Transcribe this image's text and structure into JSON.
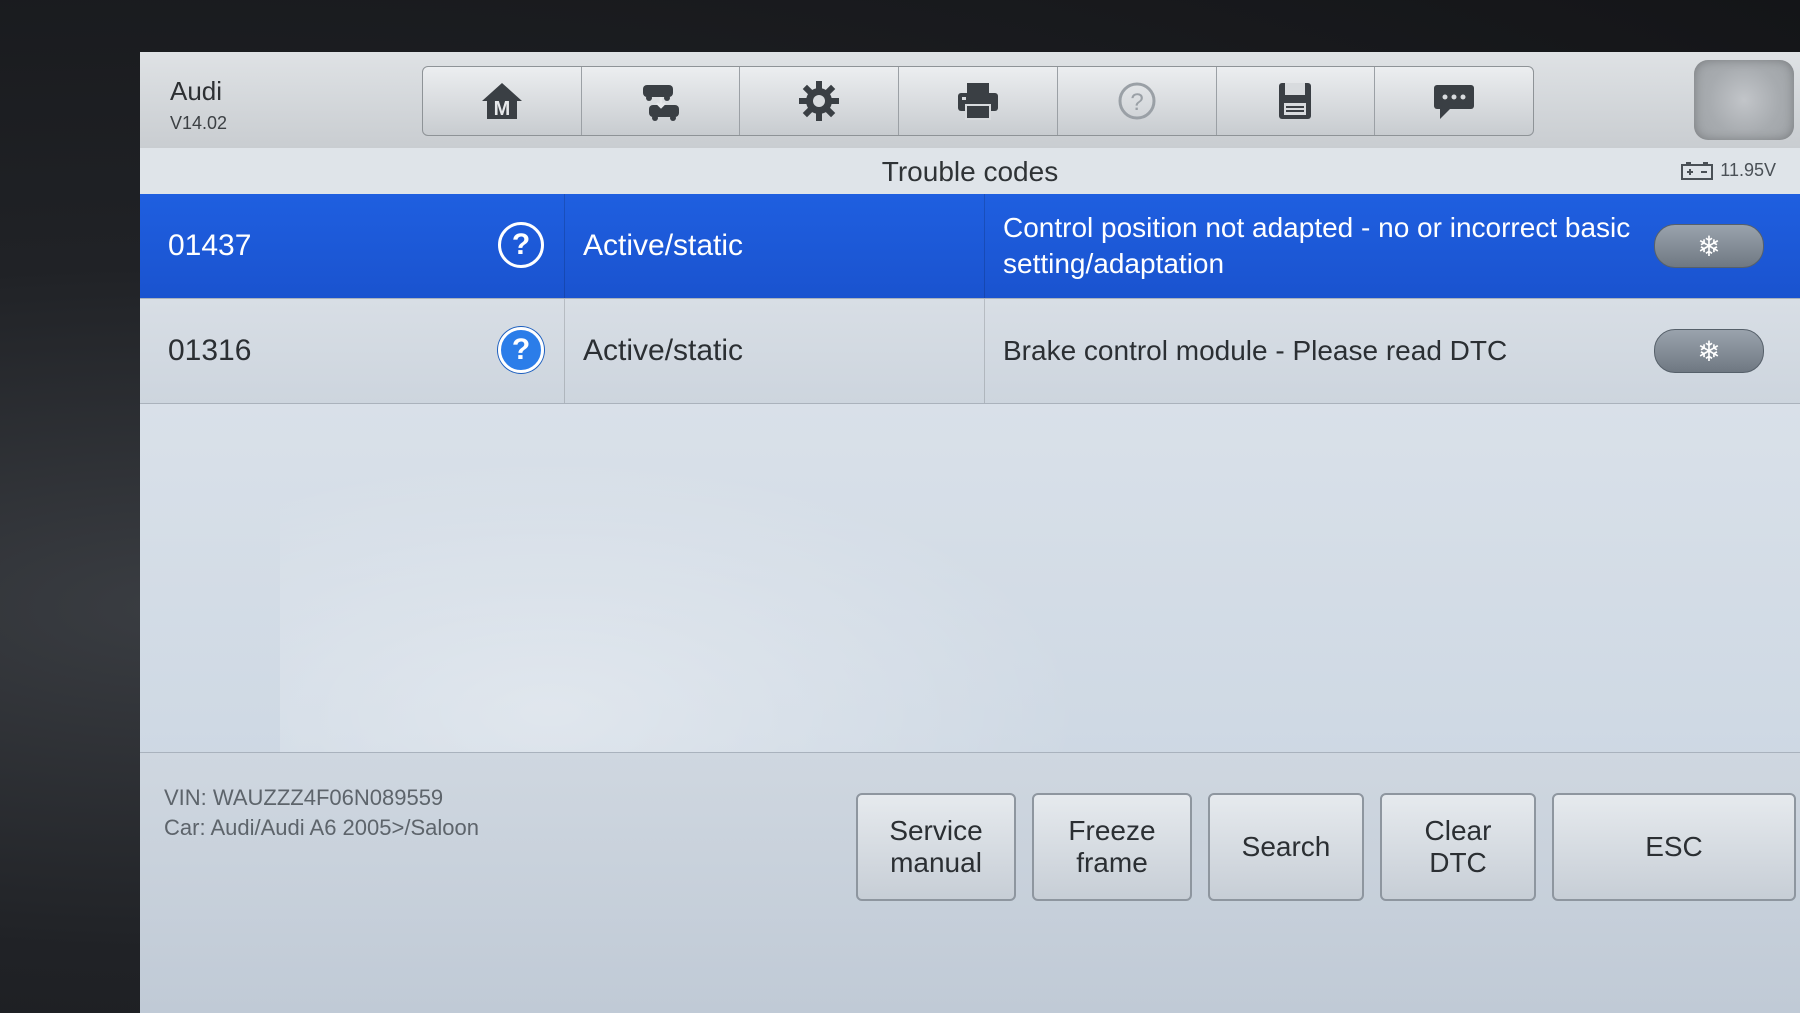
{
  "header": {
    "make": "Audi",
    "version": "V14.02"
  },
  "toolbar": {
    "buttons": [
      {
        "name": "home-m-icon"
      },
      {
        "name": "vehicle-swap-icon"
      },
      {
        "name": "gear-icon"
      },
      {
        "name": "printer-icon"
      },
      {
        "name": "help-icon"
      },
      {
        "name": "save-disk-icon"
      },
      {
        "name": "message-icon"
      }
    ]
  },
  "page": {
    "title": "Trouble codes",
    "battery_voltage": "11.95V"
  },
  "codes": [
    {
      "code": "01437",
      "status": "Active/static",
      "description": "Control position not adapted - no or incorrect basic setting/adaptation",
      "selected": true
    },
    {
      "code": "01316",
      "status": "Active/static",
      "description": "Brake control module - Please read DTC",
      "selected": false
    }
  ],
  "vehicle": {
    "vin_line": "VIN: WAUZZZ4F06N089559",
    "car_line": "Car: Audi/Audi A6 2005>/Saloon"
  },
  "actions": {
    "service_manual": "Service\nmanual",
    "freeze_frame": "Freeze\nframe",
    "search": "Search",
    "clear_dtc": "Clear\nDTC",
    "esc": "ESC"
  },
  "colors": {
    "selected_row": "#1f5fe0",
    "help_icon": "#2b7de9"
  }
}
